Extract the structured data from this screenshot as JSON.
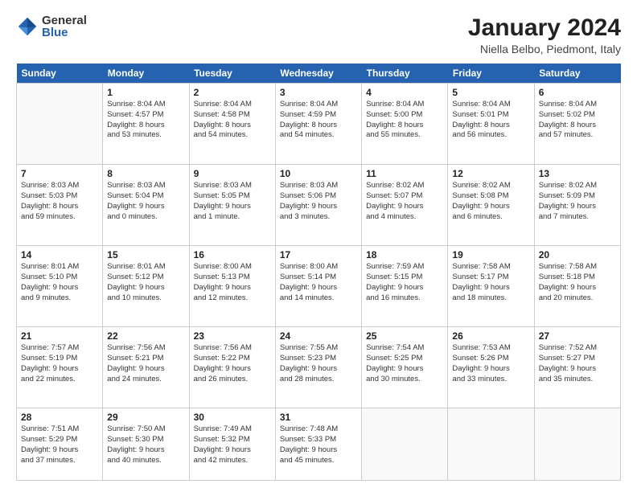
{
  "logo": {
    "general": "General",
    "blue": "Blue"
  },
  "calendar": {
    "title": "January 2024",
    "subtitle": "Niella Belbo, Piedmont, Italy",
    "days_of_week": [
      "Sunday",
      "Monday",
      "Tuesday",
      "Wednesday",
      "Thursday",
      "Friday",
      "Saturday"
    ],
    "weeks": [
      [
        {
          "day": "",
          "info": ""
        },
        {
          "day": "1",
          "info": "Sunrise: 8:04 AM\nSunset: 4:57 PM\nDaylight: 8 hours\nand 53 minutes."
        },
        {
          "day": "2",
          "info": "Sunrise: 8:04 AM\nSunset: 4:58 PM\nDaylight: 8 hours\nand 54 minutes."
        },
        {
          "day": "3",
          "info": "Sunrise: 8:04 AM\nSunset: 4:59 PM\nDaylight: 8 hours\nand 54 minutes."
        },
        {
          "day": "4",
          "info": "Sunrise: 8:04 AM\nSunset: 5:00 PM\nDaylight: 8 hours\nand 55 minutes."
        },
        {
          "day": "5",
          "info": "Sunrise: 8:04 AM\nSunset: 5:01 PM\nDaylight: 8 hours\nand 56 minutes."
        },
        {
          "day": "6",
          "info": "Sunrise: 8:04 AM\nSunset: 5:02 PM\nDaylight: 8 hours\nand 57 minutes."
        }
      ],
      [
        {
          "day": "7",
          "info": "Sunrise: 8:03 AM\nSunset: 5:03 PM\nDaylight: 8 hours\nand 59 minutes."
        },
        {
          "day": "8",
          "info": "Sunrise: 8:03 AM\nSunset: 5:04 PM\nDaylight: 9 hours\nand 0 minutes."
        },
        {
          "day": "9",
          "info": "Sunrise: 8:03 AM\nSunset: 5:05 PM\nDaylight: 9 hours\nand 1 minute."
        },
        {
          "day": "10",
          "info": "Sunrise: 8:03 AM\nSunset: 5:06 PM\nDaylight: 9 hours\nand 3 minutes."
        },
        {
          "day": "11",
          "info": "Sunrise: 8:02 AM\nSunset: 5:07 PM\nDaylight: 9 hours\nand 4 minutes."
        },
        {
          "day": "12",
          "info": "Sunrise: 8:02 AM\nSunset: 5:08 PM\nDaylight: 9 hours\nand 6 minutes."
        },
        {
          "day": "13",
          "info": "Sunrise: 8:02 AM\nSunset: 5:09 PM\nDaylight: 9 hours\nand 7 minutes."
        }
      ],
      [
        {
          "day": "14",
          "info": "Sunrise: 8:01 AM\nSunset: 5:10 PM\nDaylight: 9 hours\nand 9 minutes."
        },
        {
          "day": "15",
          "info": "Sunrise: 8:01 AM\nSunset: 5:12 PM\nDaylight: 9 hours\nand 10 minutes."
        },
        {
          "day": "16",
          "info": "Sunrise: 8:00 AM\nSunset: 5:13 PM\nDaylight: 9 hours\nand 12 minutes."
        },
        {
          "day": "17",
          "info": "Sunrise: 8:00 AM\nSunset: 5:14 PM\nDaylight: 9 hours\nand 14 minutes."
        },
        {
          "day": "18",
          "info": "Sunrise: 7:59 AM\nSunset: 5:15 PM\nDaylight: 9 hours\nand 16 minutes."
        },
        {
          "day": "19",
          "info": "Sunrise: 7:58 AM\nSunset: 5:17 PM\nDaylight: 9 hours\nand 18 minutes."
        },
        {
          "day": "20",
          "info": "Sunrise: 7:58 AM\nSunset: 5:18 PM\nDaylight: 9 hours\nand 20 minutes."
        }
      ],
      [
        {
          "day": "21",
          "info": "Sunrise: 7:57 AM\nSunset: 5:19 PM\nDaylight: 9 hours\nand 22 minutes."
        },
        {
          "day": "22",
          "info": "Sunrise: 7:56 AM\nSunset: 5:21 PM\nDaylight: 9 hours\nand 24 minutes."
        },
        {
          "day": "23",
          "info": "Sunrise: 7:56 AM\nSunset: 5:22 PM\nDaylight: 9 hours\nand 26 minutes."
        },
        {
          "day": "24",
          "info": "Sunrise: 7:55 AM\nSunset: 5:23 PM\nDaylight: 9 hours\nand 28 minutes."
        },
        {
          "day": "25",
          "info": "Sunrise: 7:54 AM\nSunset: 5:25 PM\nDaylight: 9 hours\nand 30 minutes."
        },
        {
          "day": "26",
          "info": "Sunrise: 7:53 AM\nSunset: 5:26 PM\nDaylight: 9 hours\nand 33 minutes."
        },
        {
          "day": "27",
          "info": "Sunrise: 7:52 AM\nSunset: 5:27 PM\nDaylight: 9 hours\nand 35 minutes."
        }
      ],
      [
        {
          "day": "28",
          "info": "Sunrise: 7:51 AM\nSunset: 5:29 PM\nDaylight: 9 hours\nand 37 minutes."
        },
        {
          "day": "29",
          "info": "Sunrise: 7:50 AM\nSunset: 5:30 PM\nDaylight: 9 hours\nand 40 minutes."
        },
        {
          "day": "30",
          "info": "Sunrise: 7:49 AM\nSunset: 5:32 PM\nDaylight: 9 hours\nand 42 minutes."
        },
        {
          "day": "31",
          "info": "Sunrise: 7:48 AM\nSunset: 5:33 PM\nDaylight: 9 hours\nand 45 minutes."
        },
        {
          "day": "",
          "info": ""
        },
        {
          "day": "",
          "info": ""
        },
        {
          "day": "",
          "info": ""
        }
      ]
    ]
  }
}
